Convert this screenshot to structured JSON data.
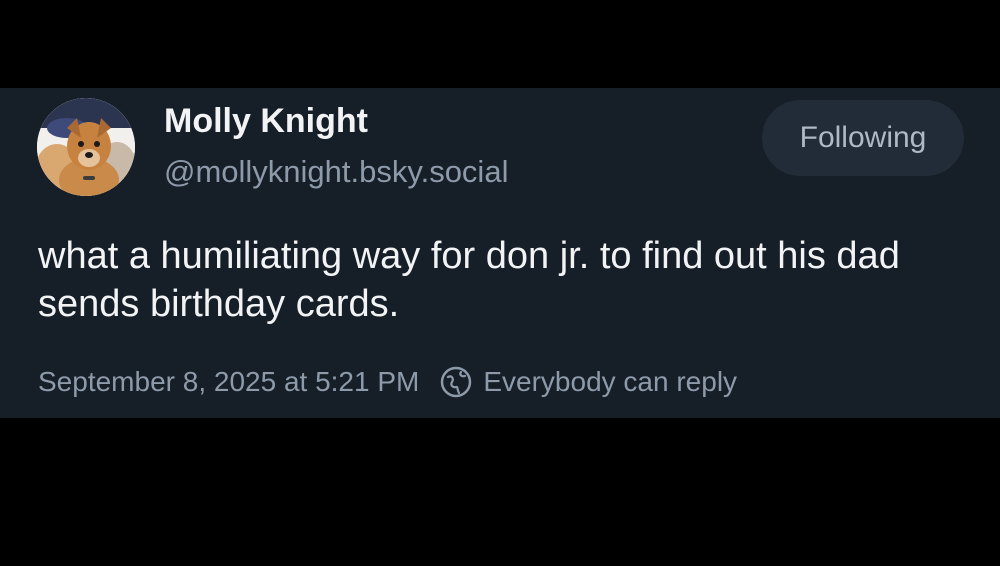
{
  "post": {
    "author": {
      "display_name": "Molly Knight",
      "handle": "@mollyknight.bsky.social",
      "avatar_icon": "dog-avatar"
    },
    "follow_button_label": "Following",
    "text": "what a humiliating way for don jr. to find out his dad sends birthday cards.",
    "timestamp": "September 8, 2025 at 5:21 PM",
    "reply_setting": {
      "icon": "globe-icon",
      "label": "Everybody can reply"
    }
  },
  "colors": {
    "page_background": "#000000",
    "card_background": "#161e27",
    "primary_text": "#f1f3f5",
    "secondary_text": "#8c9aaa",
    "button_background": "#212c38"
  }
}
